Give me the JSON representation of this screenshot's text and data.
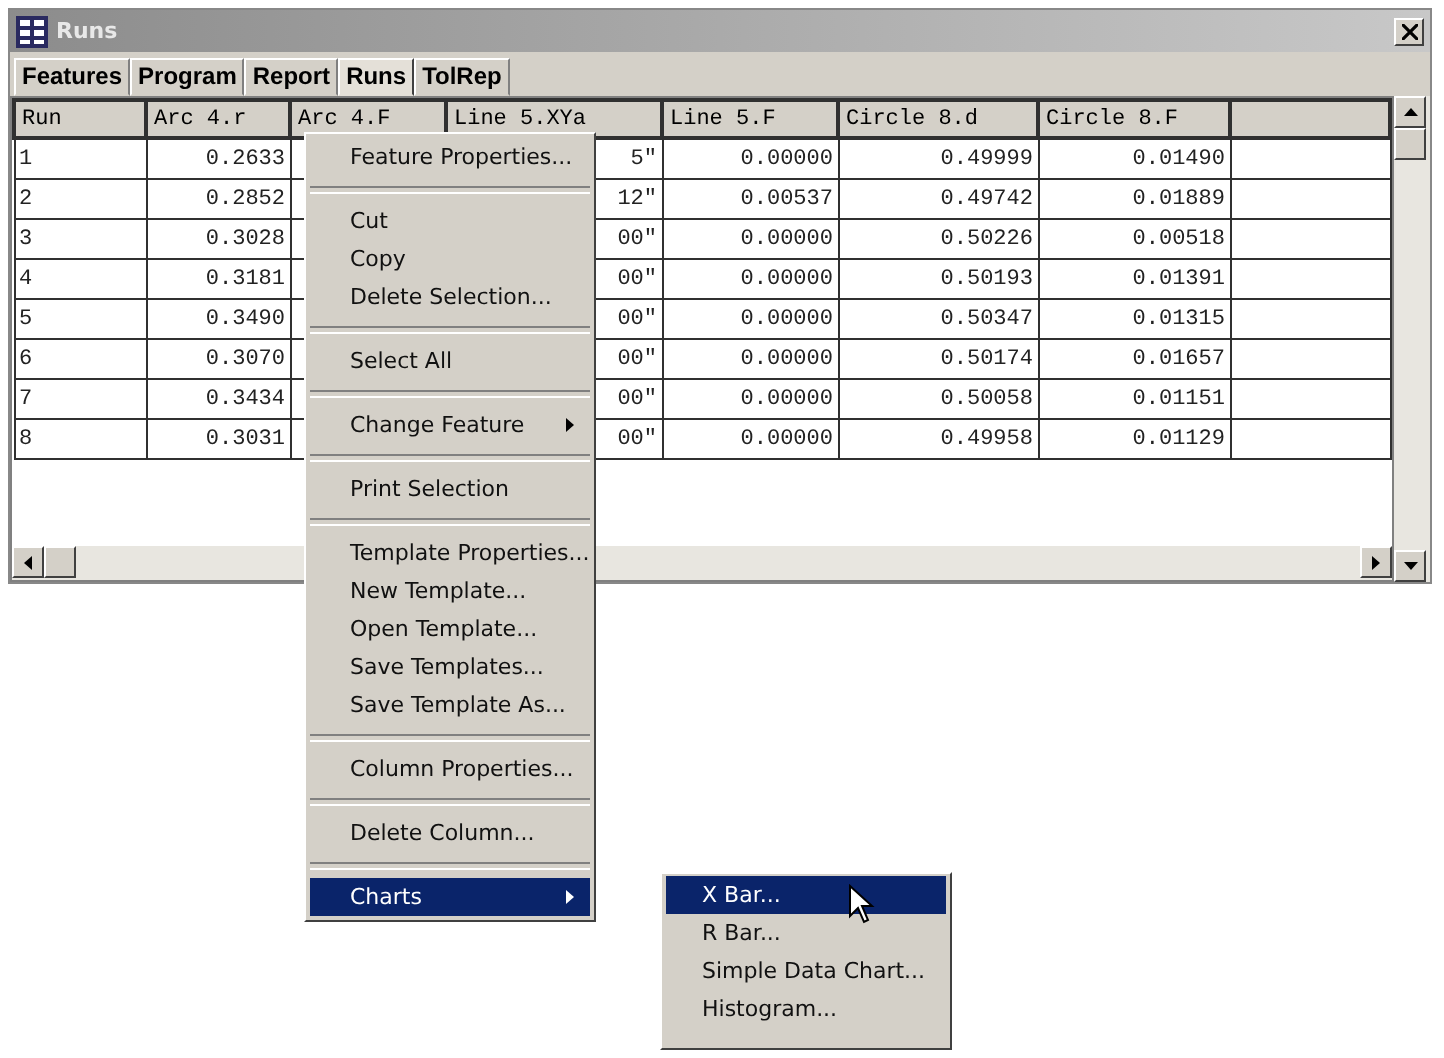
{
  "window": {
    "title": "Runs"
  },
  "tabs": [
    {
      "label": "Features",
      "selected": false
    },
    {
      "label": "Program",
      "selected": false
    },
    {
      "label": "Report",
      "selected": false
    },
    {
      "label": "Runs",
      "selected": true
    },
    {
      "label": "TolRep",
      "selected": false
    }
  ],
  "table": {
    "columns": [
      "Run",
      "Arc 4.r",
      "Arc 4.F",
      "Line 5.XYa",
      "Line 5.F",
      "Circle 8.d",
      "Circle 8.F"
    ],
    "rows": [
      [
        "1",
        "0.2633",
        "",
        "5\"",
        "0.00000",
        "0.49999",
        "0.01490"
      ],
      [
        "2",
        "0.2852",
        "",
        "12\"",
        "0.00537",
        "0.49742",
        "0.01889"
      ],
      [
        "3",
        "0.3028",
        "",
        "00\"",
        "0.00000",
        "0.50226",
        "0.00518"
      ],
      [
        "4",
        "0.3181",
        "",
        "00\"",
        "0.00000",
        "0.50193",
        "0.01391"
      ],
      [
        "5",
        "0.3490",
        "",
        "00\"",
        "0.00000",
        "0.50347",
        "0.01315"
      ],
      [
        "6",
        "0.3070",
        "",
        "00\"",
        "0.00000",
        "0.50174",
        "0.01657"
      ],
      [
        "7",
        "0.3434",
        "",
        "00\"",
        "0.00000",
        "0.50058",
        "0.01151"
      ],
      [
        "8",
        "0.3031",
        "",
        "00\"",
        "0.00000",
        "0.49958",
        "0.01129"
      ]
    ]
  },
  "context_menu": {
    "items": [
      {
        "kind": "item",
        "label": "Feature Properties...",
        "submenu": false,
        "selected": false
      },
      {
        "kind": "separator"
      },
      {
        "kind": "item",
        "label": "Cut",
        "submenu": false,
        "selected": false
      },
      {
        "kind": "item",
        "label": "Copy",
        "submenu": false,
        "selected": false
      },
      {
        "kind": "item",
        "label": "Delete Selection...",
        "submenu": false,
        "selected": false
      },
      {
        "kind": "separator"
      },
      {
        "kind": "item",
        "label": "Select All",
        "submenu": false,
        "selected": false
      },
      {
        "kind": "separator"
      },
      {
        "kind": "item",
        "label": "Change Feature",
        "submenu": true,
        "selected": false
      },
      {
        "kind": "separator"
      },
      {
        "kind": "item",
        "label": "Print Selection",
        "submenu": false,
        "selected": false
      },
      {
        "kind": "separator"
      },
      {
        "kind": "item",
        "label": "Template Properties...",
        "submenu": false,
        "selected": false
      },
      {
        "kind": "item",
        "label": "New Template...",
        "submenu": false,
        "selected": false
      },
      {
        "kind": "item",
        "label": "Open Template...",
        "submenu": false,
        "selected": false
      },
      {
        "kind": "item",
        "label": "Save Templates...",
        "submenu": false,
        "selected": false
      },
      {
        "kind": "item",
        "label": "Save Template As...",
        "submenu": false,
        "selected": false
      },
      {
        "kind": "separator"
      },
      {
        "kind": "item",
        "label": "Column Properties...",
        "submenu": false,
        "selected": false
      },
      {
        "kind": "separator"
      },
      {
        "kind": "item",
        "label": "Delete Column...",
        "submenu": false,
        "selected": false
      },
      {
        "kind": "separator"
      },
      {
        "kind": "item",
        "label": "Charts",
        "submenu": true,
        "selected": true
      }
    ]
  },
  "charts_submenu": {
    "items": [
      {
        "label": "X Bar...",
        "selected": true
      },
      {
        "label": "R Bar...",
        "selected": false
      },
      {
        "label": "Simple Data Chart...",
        "selected": false
      },
      {
        "label": "Histogram...",
        "selected": false
      }
    ]
  }
}
